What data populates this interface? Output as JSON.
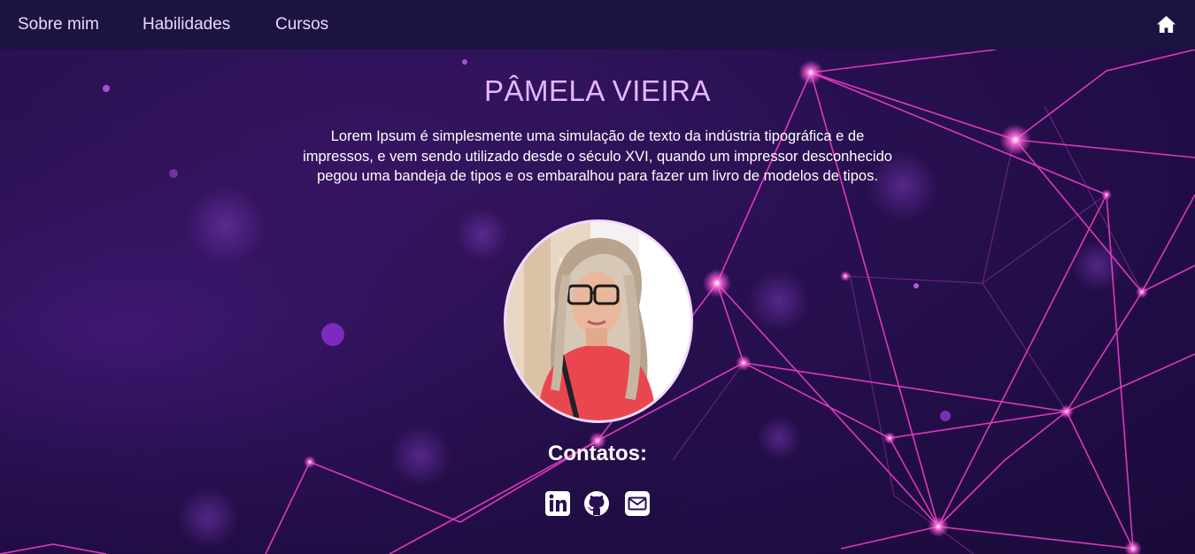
{
  "nav": {
    "items": [
      {
        "label": "Sobre mim"
      },
      {
        "label": "Habilidades"
      },
      {
        "label": "Cursos"
      }
    ],
    "home_icon": "home-icon"
  },
  "profile": {
    "name": "PÂMELA VIEIRA",
    "bio": "Lorem Ipsum é simplesmente uma simulação de texto da indústria tipográfica e de impressos, e vem sendo utilizado desde o século XVI, quando um impressor desconhecido pegou uma bandeja de tipos e os embaralhou para fazer um livro de modelos de tipos.",
    "photo": "profile-photo"
  },
  "contacts": {
    "title": "Contatos:",
    "icons": [
      "linkedin-icon",
      "github-icon",
      "email-icon"
    ]
  },
  "colors": {
    "nav_bg": "#1b1440",
    "nav_text": "#f0d4ff",
    "name": "#e6b6ff",
    "accent_lines": "#ff3fd0",
    "background": "#27104f"
  }
}
